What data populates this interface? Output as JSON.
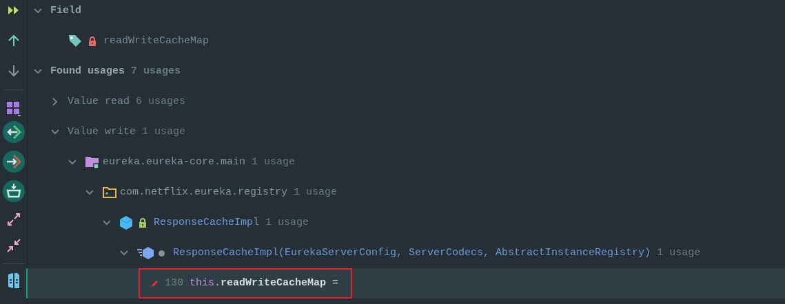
{
  "tree": [
    {
      "kind": "group",
      "label": "Field",
      "expanded": true,
      "children": [
        {
          "kind": "field",
          "label": "readWriteCacheMap",
          "private": true
        }
      ]
    },
    {
      "kind": "group",
      "label": "Found usages",
      "count": "7 usages",
      "expanded": true,
      "children": [
        {
          "kind": "category",
          "label": "Value read",
          "count": "6 usages",
          "expanded": false
        },
        {
          "kind": "category",
          "label": "Value write",
          "count": "1 usage",
          "expanded": true,
          "children": [
            {
              "kind": "module",
              "label": "eureka.eureka-core.main",
              "count": "1 usage",
              "expanded": true,
              "children": [
                {
                  "kind": "package",
                  "label": "com.netflix.eureka.registry",
                  "count": "1 usage",
                  "expanded": true,
                  "children": [
                    {
                      "kind": "class",
                      "label": "ResponseCacheImpl",
                      "count": "1 usage",
                      "expanded": true,
                      "children": [
                        {
                          "kind": "method",
                          "label": "ResponseCacheImpl(EurekaServerConfig, ServerCodecs, AbstractInstanceRegistry)",
                          "count": "1 usage",
                          "expanded": true,
                          "children": [
                            {
                              "kind": "usage",
                              "line": "130",
                              "selected": true,
                              "annotated": true,
                              "parts": [
                                {
                                  "kind": "keyword",
                                  "text": "this"
                                },
                                {
                                  "kind": "plain",
                                  "text": "."
                                },
                                {
                                  "kind": "bold",
                                  "text": "readWriteCacheMap"
                                },
                                {
                                  "kind": "plain",
                                  "text": " ="
                                }
                              ]
                            }
                          ]
                        }
                      ]
                    }
                  ]
                }
              ]
            }
          ]
        }
      ]
    }
  ]
}
